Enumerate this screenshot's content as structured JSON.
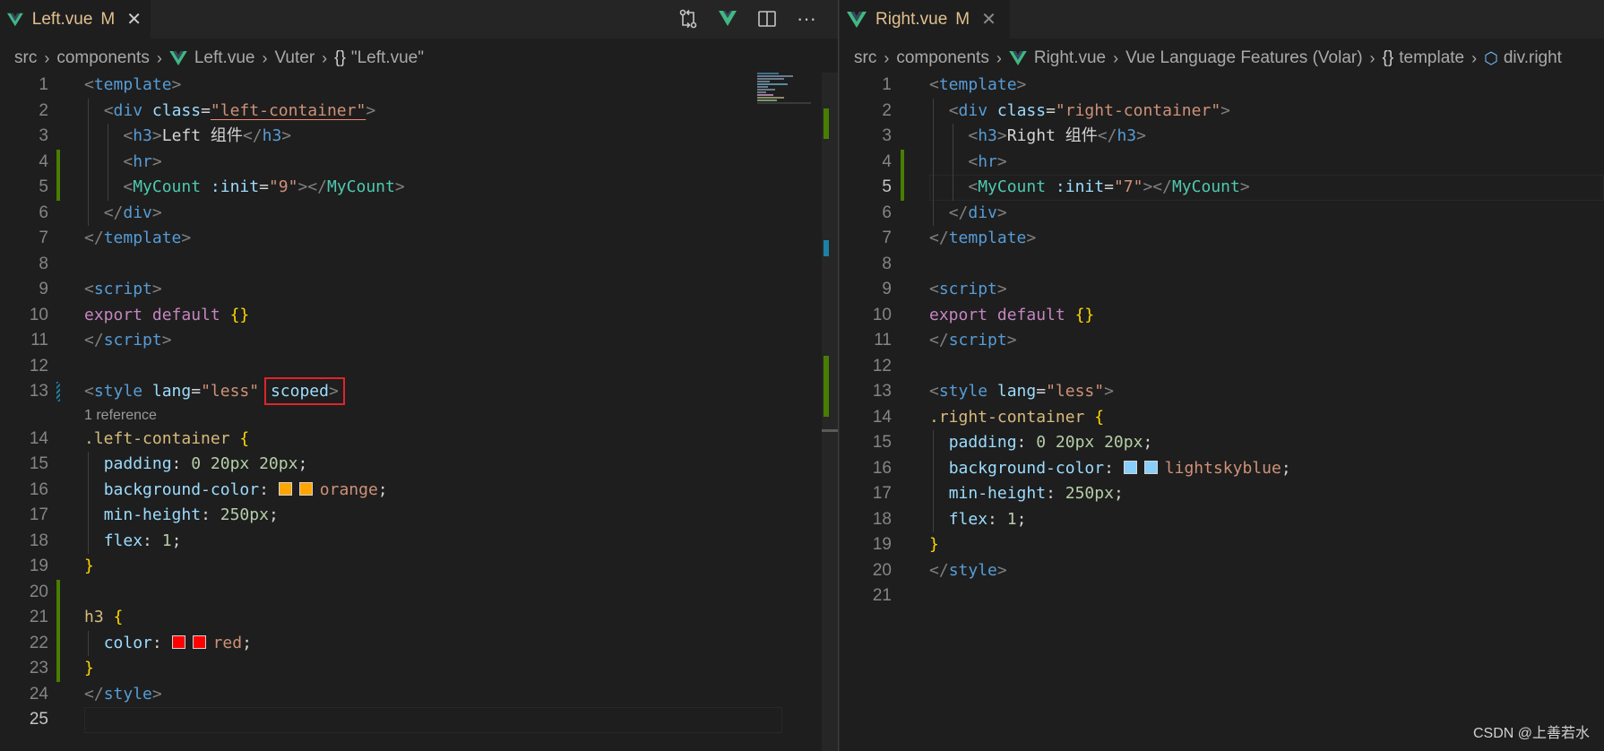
{
  "colors": {
    "tab_label": "#e2c08d",
    "gutter_added": "#487e02",
    "highlight_box": "#e0242a",
    "vue_icon": "#41b883"
  },
  "left": {
    "tab": {
      "name": "Left.vue",
      "status": "M",
      "close": "✕"
    },
    "actions": [
      "compare-changes-icon",
      "vue-split-icon",
      "split-editor-icon",
      "more-actions-icon"
    ],
    "actions_glyphs": {
      "more": "···"
    },
    "breadcrumb": [
      "src",
      "components",
      "Left.vue",
      "Vuter",
      "\"Left.vue\""
    ],
    "braces": "{}",
    "code": {
      "l1": [
        "<",
        "template",
        ">"
      ],
      "l2": [
        "<",
        "div",
        "class",
        "=",
        "\"left-container\"",
        ">"
      ],
      "l3": [
        "<",
        "h3",
        ">",
        "Left 组件",
        "</",
        "h3",
        ">"
      ],
      "l4": [
        "<",
        "hr",
        ">"
      ],
      "l5": [
        "<",
        "MyCount",
        ":init",
        "=",
        "\"9\"",
        "></",
        "MyCount",
        ">"
      ],
      "l6": [
        "</",
        "div",
        ">"
      ],
      "l7": [
        "</",
        "template",
        ">"
      ],
      "l9": [
        "<",
        "script",
        ">"
      ],
      "l10": [
        "export",
        "default",
        "{}"
      ],
      "l11": [
        "</",
        "script",
        ">"
      ],
      "l13": [
        "<",
        "style",
        "lang",
        "=",
        "\"less\"",
        "scoped",
        ">"
      ],
      "codelens": "1 reference",
      "l14": [
        ".left-container",
        "{"
      ],
      "l15": [
        "padding",
        ":",
        "0 20px 20px",
        ";"
      ],
      "l16": [
        "background-color",
        ":",
        "orange",
        ";"
      ],
      "l17": [
        "min-height",
        ":",
        "250px",
        ";"
      ],
      "l18": [
        "flex",
        ":",
        "1",
        ";"
      ],
      "l19": [
        "}"
      ],
      "l21": [
        "h3",
        "{"
      ],
      "l22": [
        "color",
        ":",
        "red",
        ";"
      ],
      "l23": [
        "}"
      ],
      "l24": [
        "</",
        "style",
        ">"
      ]
    },
    "swatch_colors": {
      "orange": "#ffa500",
      "red": "#ff0000"
    },
    "line_numbers": [
      "1",
      "2",
      "3",
      "4",
      "5",
      "6",
      "7",
      "8",
      "9",
      "10",
      "11",
      "12",
      "13",
      "14",
      "15",
      "16",
      "17",
      "18",
      "19",
      "20",
      "21",
      "22",
      "23",
      "24",
      "25"
    ]
  },
  "right": {
    "tab": {
      "name": "Right.vue",
      "status": "M",
      "close": "✕"
    },
    "breadcrumb": [
      "src",
      "components",
      "Right.vue",
      "Vue Language Features (Volar)",
      "template",
      "div.right"
    ],
    "braces": "{}",
    "code": {
      "l1": [
        "<",
        "template",
        ">"
      ],
      "l2": [
        "<",
        "div",
        "class",
        "=",
        "\"right-container\"",
        ">"
      ],
      "l3": [
        "<",
        "h3",
        ">",
        "Right 组件",
        "</",
        "h3",
        ">"
      ],
      "l4": [
        "<",
        "hr",
        ">"
      ],
      "l5": [
        "<",
        "MyCount",
        ":init",
        "=",
        "\"7\"",
        "></",
        "MyCount",
        ">"
      ],
      "l6": [
        "</",
        "div",
        ">"
      ],
      "l7": [
        "</",
        "template",
        ">"
      ],
      "l9": [
        "<",
        "script",
        ">"
      ],
      "l10": [
        "export",
        "default",
        "{}"
      ],
      "l11": [
        "</",
        "script",
        ">"
      ],
      "l13": [
        "<",
        "style",
        "lang",
        "=",
        "\"less\"",
        ">"
      ],
      "l14": [
        ".right-container",
        "{"
      ],
      "l15": [
        "padding",
        ":",
        "0 20px 20px",
        ";"
      ],
      "l16": [
        "background-color",
        ":",
        "lightskyblue",
        ";"
      ],
      "l17": [
        "min-height",
        ":",
        "250px",
        ";"
      ],
      "l18": [
        "flex",
        ":",
        "1",
        ";"
      ],
      "l19": [
        "}"
      ],
      "l20": [
        "</",
        "style",
        ">"
      ]
    },
    "swatch_colors": {
      "lightskyblue": "#87cefa"
    },
    "line_numbers": [
      "1",
      "2",
      "3",
      "4",
      "5",
      "6",
      "7",
      "8",
      "9",
      "10",
      "11",
      "12",
      "13",
      "14",
      "15",
      "16",
      "17",
      "18",
      "19",
      "20",
      "21"
    ]
  },
  "watermark": "CSDN @上善若水"
}
